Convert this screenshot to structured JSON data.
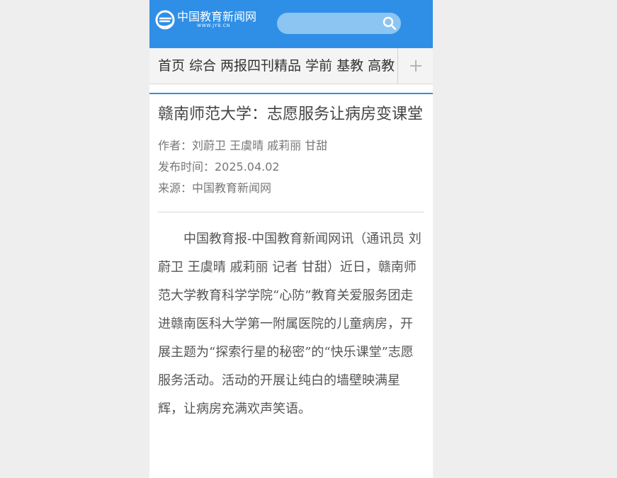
{
  "header": {
    "logo_cn": "中国教育新闻网",
    "logo_url": "WWW.JYB.CN",
    "search_placeholder": ""
  },
  "nav": {
    "items": [
      "首页",
      "综合",
      "两报四刊精品",
      "学前",
      "基教",
      "高教"
    ],
    "plus": "+"
  },
  "article": {
    "title": "赣南师范大学：志愿服务让病房变课堂",
    "author": "作者：刘蔚卫 王虞晴 戚莉丽 甘甜",
    "date": "发布时间：2025.04.02",
    "source": "来源：中国教育新闻网",
    "body": "中国教育报-中国教育新闻网讯（通讯员 刘蔚卫 王虞晴 戚莉丽 记者 甘甜）近日，赣南师范大学教育科学学院“心防”教育关爱服务团走进赣南医科大学第一附属医院的儿童病房，开展主题为“探索行星的秘密”的“快乐课堂”志愿服务活动。活动的开展让纯白的墙壁映满星辉，让病房充满欢声笑语。"
  },
  "colors": {
    "brand_blue": "#2f8fe6",
    "search_bg": "#8cc4f2"
  }
}
